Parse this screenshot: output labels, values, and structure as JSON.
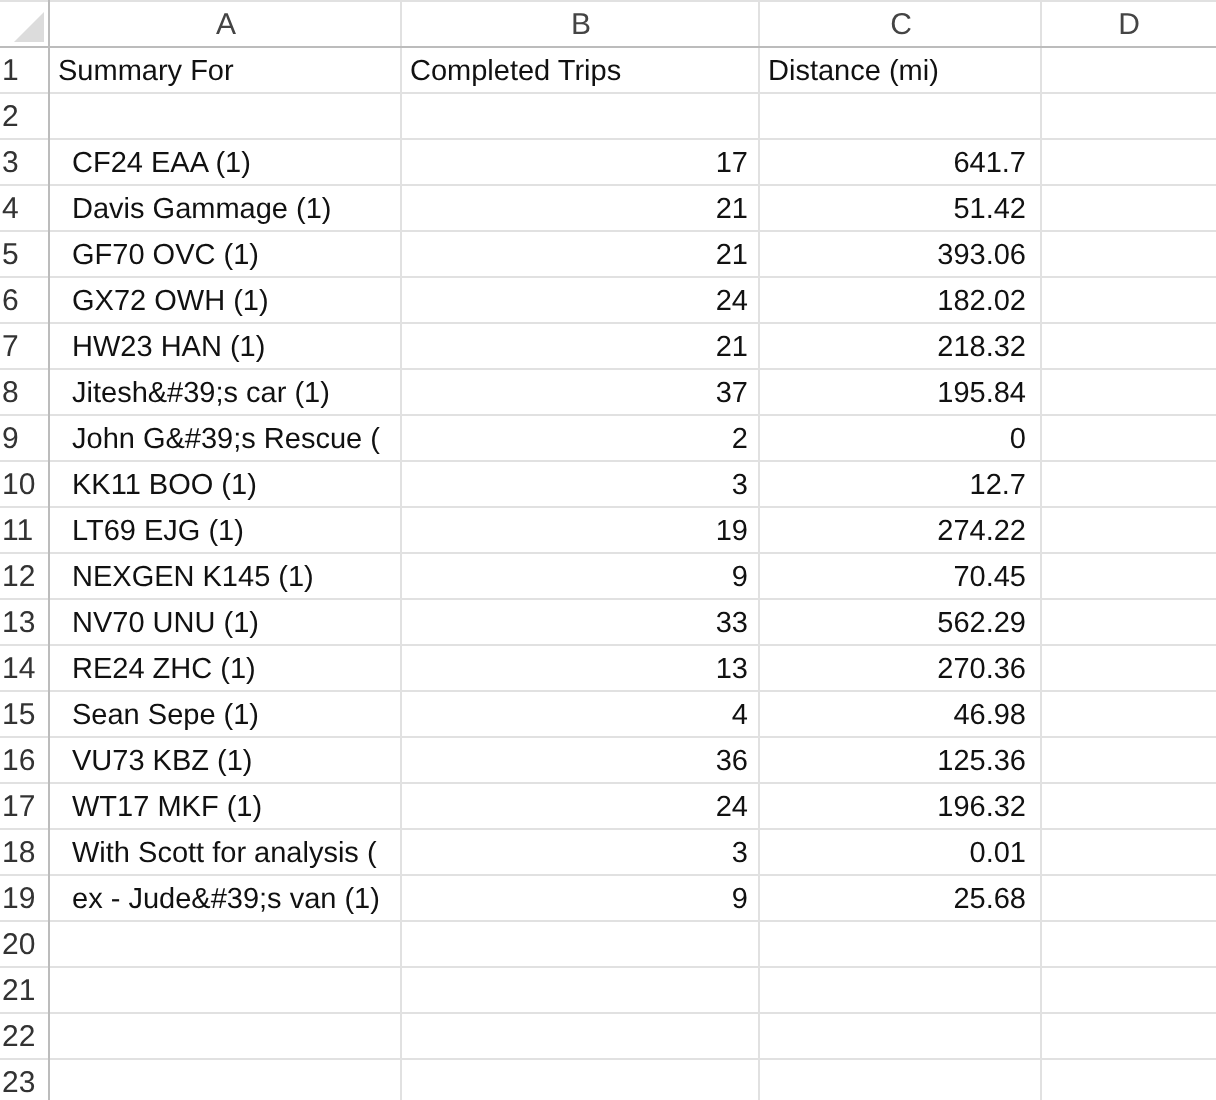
{
  "column_headers": [
    "A",
    "B",
    "C",
    "D"
  ],
  "header_row": {
    "row": "1",
    "summary_for": "Summary For",
    "completed_trips": "Completed Trips",
    "distance": "Distance (mi)"
  },
  "rows": [
    {
      "row": "2"
    },
    {
      "row": "3",
      "summary_for": "CF24 EAA (1)",
      "completed_trips": "17",
      "distance": "641.7"
    },
    {
      "row": "4",
      "summary_for": "Davis Gammage (1)",
      "completed_trips": "21",
      "distance": "51.42"
    },
    {
      "row": "5",
      "summary_for": "GF70 OVC (1)",
      "completed_trips": "21",
      "distance": "393.06"
    },
    {
      "row": "6",
      "summary_for": "GX72 OWH (1)",
      "completed_trips": "24",
      "distance": "182.02"
    },
    {
      "row": "7",
      "summary_for": "HW23 HAN (1)",
      "completed_trips": "21",
      "distance": "218.32"
    },
    {
      "row": "8",
      "summary_for": "Jitesh&#39;s car (1)",
      "completed_trips": "37",
      "distance": "195.84"
    },
    {
      "row": "9",
      "summary_for": "John G&#39;s Rescue (",
      "completed_trips": "2",
      "distance": "0"
    },
    {
      "row": "10",
      "summary_for": "KK11 BOO (1)",
      "completed_trips": "3",
      "distance": "12.7"
    },
    {
      "row": "11",
      "summary_for": "LT69 EJG (1)",
      "completed_trips": "19",
      "distance": "274.22"
    },
    {
      "row": "12",
      "summary_for": "NEXGEN K145 (1)",
      "completed_trips": "9",
      "distance": "70.45"
    },
    {
      "row": "13",
      "summary_for": "NV70 UNU (1)",
      "completed_trips": "33",
      "distance": "562.29"
    },
    {
      "row": "14",
      "summary_for": "RE24 ZHC (1)",
      "completed_trips": "13",
      "distance": "270.36"
    },
    {
      "row": "15",
      "summary_for": "Sean Sepe (1)",
      "completed_trips": "4",
      "distance": "46.98"
    },
    {
      "row": "16",
      "summary_for": "VU73 KBZ (1)",
      "completed_trips": "36",
      "distance": "125.36"
    },
    {
      "row": "17",
      "summary_for": "WT17 MKF (1)",
      "completed_trips": "24",
      "distance": "196.32"
    },
    {
      "row": "18",
      "summary_for": "With Scott for analysis (",
      "completed_trips": "3",
      "distance": "0.01"
    },
    {
      "row": "19",
      "summary_for": "ex - Jude&#39;s van (1)",
      "completed_trips": "9",
      "distance": "25.68"
    },
    {
      "row": "20"
    },
    {
      "row": "21"
    },
    {
      "row": "22"
    },
    {
      "row": "23"
    }
  ]
}
